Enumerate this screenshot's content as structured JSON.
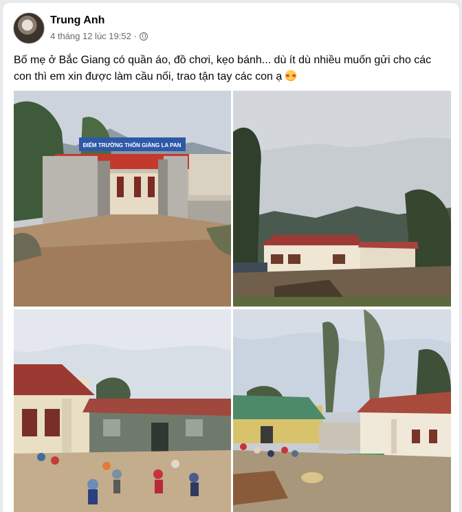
{
  "post": {
    "author": "Trung Anh",
    "timestamp": "4 tháng 12 lúc 19:52 ·",
    "privacy_icon": "globe-icon",
    "text": "Bố mẹ ở Bắc Giang có quần áo, đồ chơi, kẹo bánh... dù ít dù nhiều muốn gửi cho các con thì em xin được làm cầu nối, trao tận tay các con ạ",
    "emoji_icon": "smiling-face-with-hearts-icon",
    "photos": {
      "school_sign": "ĐIỂM TRƯỜNG THÔN GIÀNG LA PAN"
    }
  }
}
